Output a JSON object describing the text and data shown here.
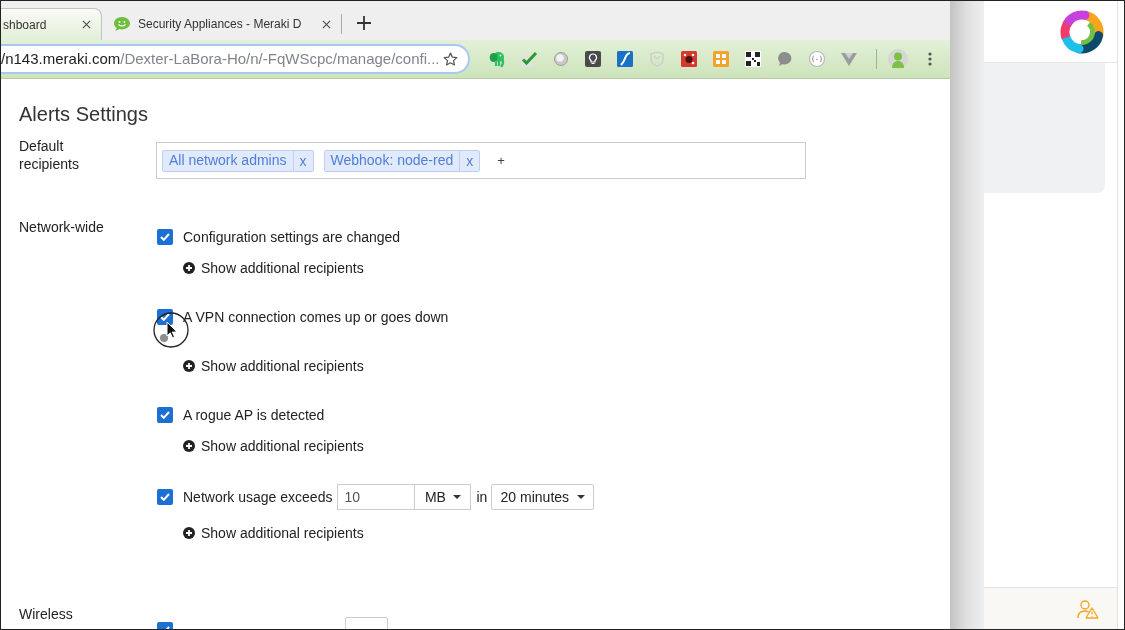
{
  "browser": {
    "tabs": [
      {
        "title": "shboard",
        "selected": true
      },
      {
        "title": "Security Appliances - Meraki D",
        "selected": false
      }
    ],
    "address_bar": {
      "host": "/n143.meraki.com",
      "path": "/Dexter-LaBora-Ho/n/-FqWScpc/manage/confi..."
    }
  },
  "page": {
    "title": "Alerts Settings",
    "default_recipients": {
      "label": "Default recipients",
      "chips": [
        {
          "label": "All network admins",
          "remove": "x"
        },
        {
          "label": "Webhook: node-red",
          "remove": "x"
        }
      ],
      "add": "+"
    },
    "sections": [
      {
        "label": "Network-wide",
        "alerts": [
          {
            "kind": "simple",
            "label": "Configuration settings are changed",
            "checked": true,
            "link": "Show additional recipients"
          },
          {
            "kind": "simple",
            "label": "A VPN connection comes up or goes down",
            "checked": true,
            "link": "Show additional recipients"
          },
          {
            "kind": "simple",
            "label": "A rogue AP is detected",
            "checked": true,
            "link": "Show additional recipients"
          },
          {
            "kind": "usage",
            "label": "Network usage exceeds",
            "checked": true,
            "amount": "10",
            "unit": "MB",
            "joiner": "in",
            "period": "20 minutes",
            "link": "Show additional recipients"
          }
        ]
      },
      {
        "label": "Wireless",
        "alerts": [
          {
            "kind": "cut",
            "checked": true
          }
        ]
      }
    ]
  }
}
